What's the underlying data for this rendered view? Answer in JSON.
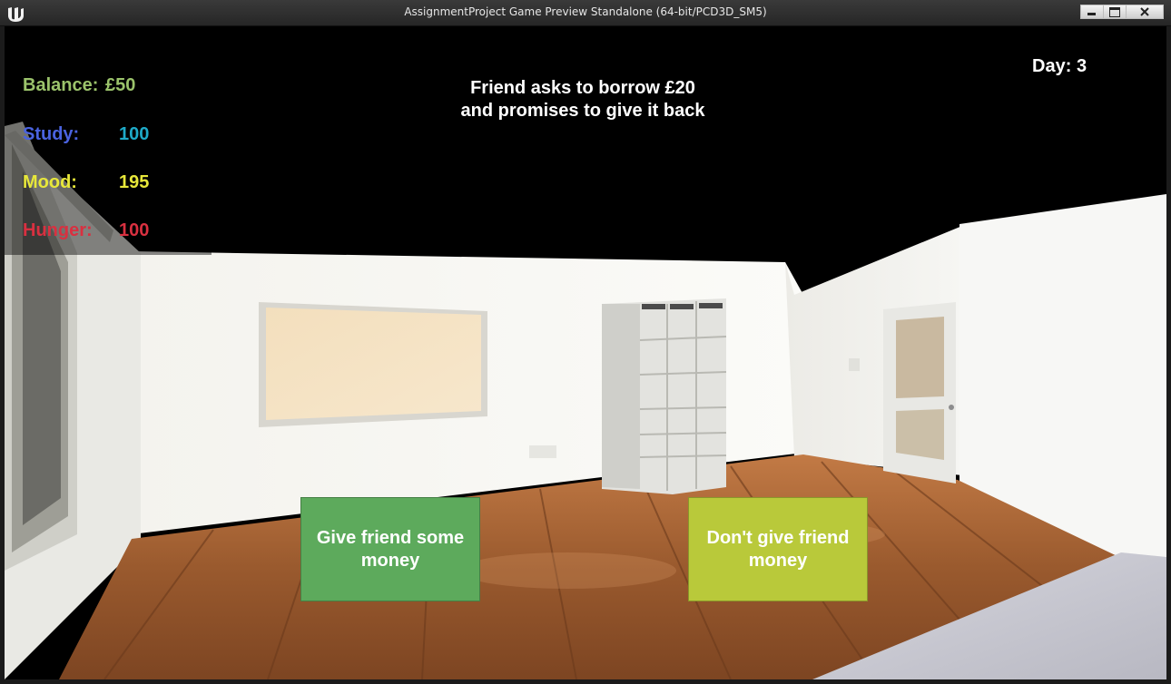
{
  "window": {
    "title": "AssignmentProject Game Preview Standalone (64-bit/PCD3D_SM5)",
    "logo_icon": "unreal-engine-icon",
    "controls": [
      "minimize-icon",
      "maximize-icon",
      "close-icon"
    ]
  },
  "hud": {
    "stats": [
      {
        "label": "Balance:",
        "value": "£50",
        "label_color": "#9bc36b",
        "value_color": "#9bc36b"
      },
      {
        "label": "Study:",
        "value": "100",
        "label_color": "#4a63e0",
        "value_color": "#1eaac8"
      },
      {
        "label": "Mood:",
        "value": "195",
        "label_color": "#e8e83a",
        "value_color": "#e8e83a"
      },
      {
        "label": "Hunger:",
        "value": "100",
        "label_color": "#d93040",
        "value_color": "#d93040"
      }
    ],
    "event_text": "Friend asks to borrow £20\nand promises to give it back",
    "day_label": "Day:",
    "day_value": "3"
  },
  "choices": [
    {
      "label": "Give friend some money",
      "color": "#5daa5c"
    },
    {
      "label": "Don't give friend money",
      "color": "#b9c93a"
    }
  ]
}
